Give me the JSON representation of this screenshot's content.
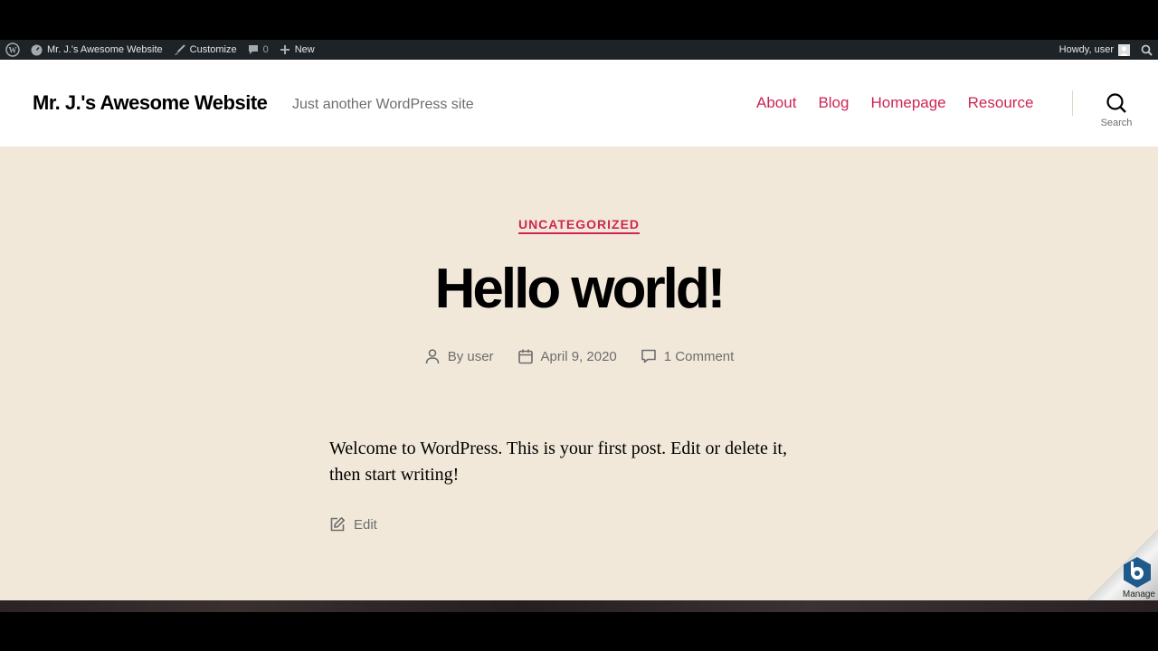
{
  "adminbar": {
    "wp_logo": "wordpress-logo-icon",
    "site_name": "Mr. J.'s Awesome Website",
    "customize": "Customize",
    "comments_count": "0",
    "new": "New",
    "howdy": "Howdy, user"
  },
  "header": {
    "site_title": "Mr. J.'s Awesome Website",
    "tagline": "Just another WordPress site",
    "nav": [
      {
        "label": "About"
      },
      {
        "label": "Blog"
      },
      {
        "label": "Homepage"
      },
      {
        "label": "Resource"
      }
    ],
    "search_label": "Search"
  },
  "post": {
    "category": "UNCATEGORIZED",
    "title": "Hello world!",
    "author": "By user",
    "date": "April 9, 2020",
    "comments": "1 Comment",
    "body": "Welcome to WordPress. This is your first post. Edit or delete it, then start writing!",
    "edit_label": "Edit"
  },
  "manage_widget": {
    "label": "Manage"
  },
  "colors": {
    "accent": "#cd2653",
    "background": "#f1e8d9",
    "adminbar": "#1d2327"
  }
}
